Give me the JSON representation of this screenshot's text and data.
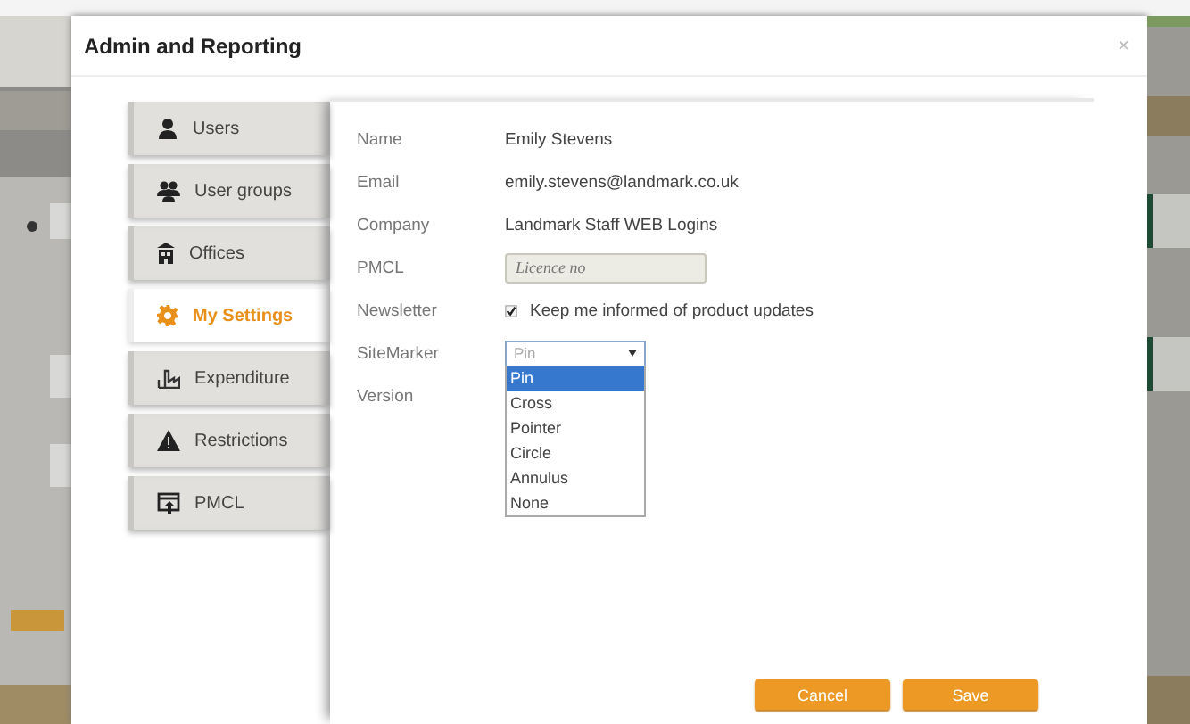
{
  "window": {
    "title": "Admin and Reporting",
    "close": "×"
  },
  "nav": [
    {
      "label": "Users",
      "selected": false
    },
    {
      "label": "User groups",
      "selected": false
    },
    {
      "label": "Offices",
      "selected": false
    },
    {
      "label": "My Settings",
      "selected": true
    },
    {
      "label": "Expenditure",
      "selected": false
    },
    {
      "label": "Restrictions",
      "selected": false
    },
    {
      "label": "PMCL",
      "selected": false
    }
  ],
  "form": [
    {
      "kind": "text",
      "label": "Name",
      "value": "Emily Stevens"
    },
    {
      "kind": "text",
      "label": "Email",
      "value": "emily.stevens@landmark.co.uk"
    },
    {
      "kind": "text",
      "label": "Company",
      "value": "Landmark Staff WEB Logins"
    },
    {
      "kind": "input",
      "label": "PMCL",
      "placeholder": "Licence no",
      "disabled": true
    },
    {
      "kind": "checkbox",
      "label": "Newsletter",
      "checked": true,
      "text": "Keep me informed of product updates"
    },
    {
      "kind": "select",
      "label": "SiteMarker",
      "value": "Pin",
      "expanded": true,
      "options": [
        {
          "label": "Pin",
          "selected": true
        },
        {
          "label": "Cross",
          "selected": false
        },
        {
          "label": "Pointer",
          "selected": false
        },
        {
          "label": "Circle",
          "selected": false
        },
        {
          "label": "Annulus",
          "selected": false
        },
        {
          "label": "None",
          "selected": false
        }
      ]
    },
    {
      "kind": "label",
      "label": "Version"
    }
  ],
  "buttons": [
    "Cancel",
    "Save"
  ]
}
